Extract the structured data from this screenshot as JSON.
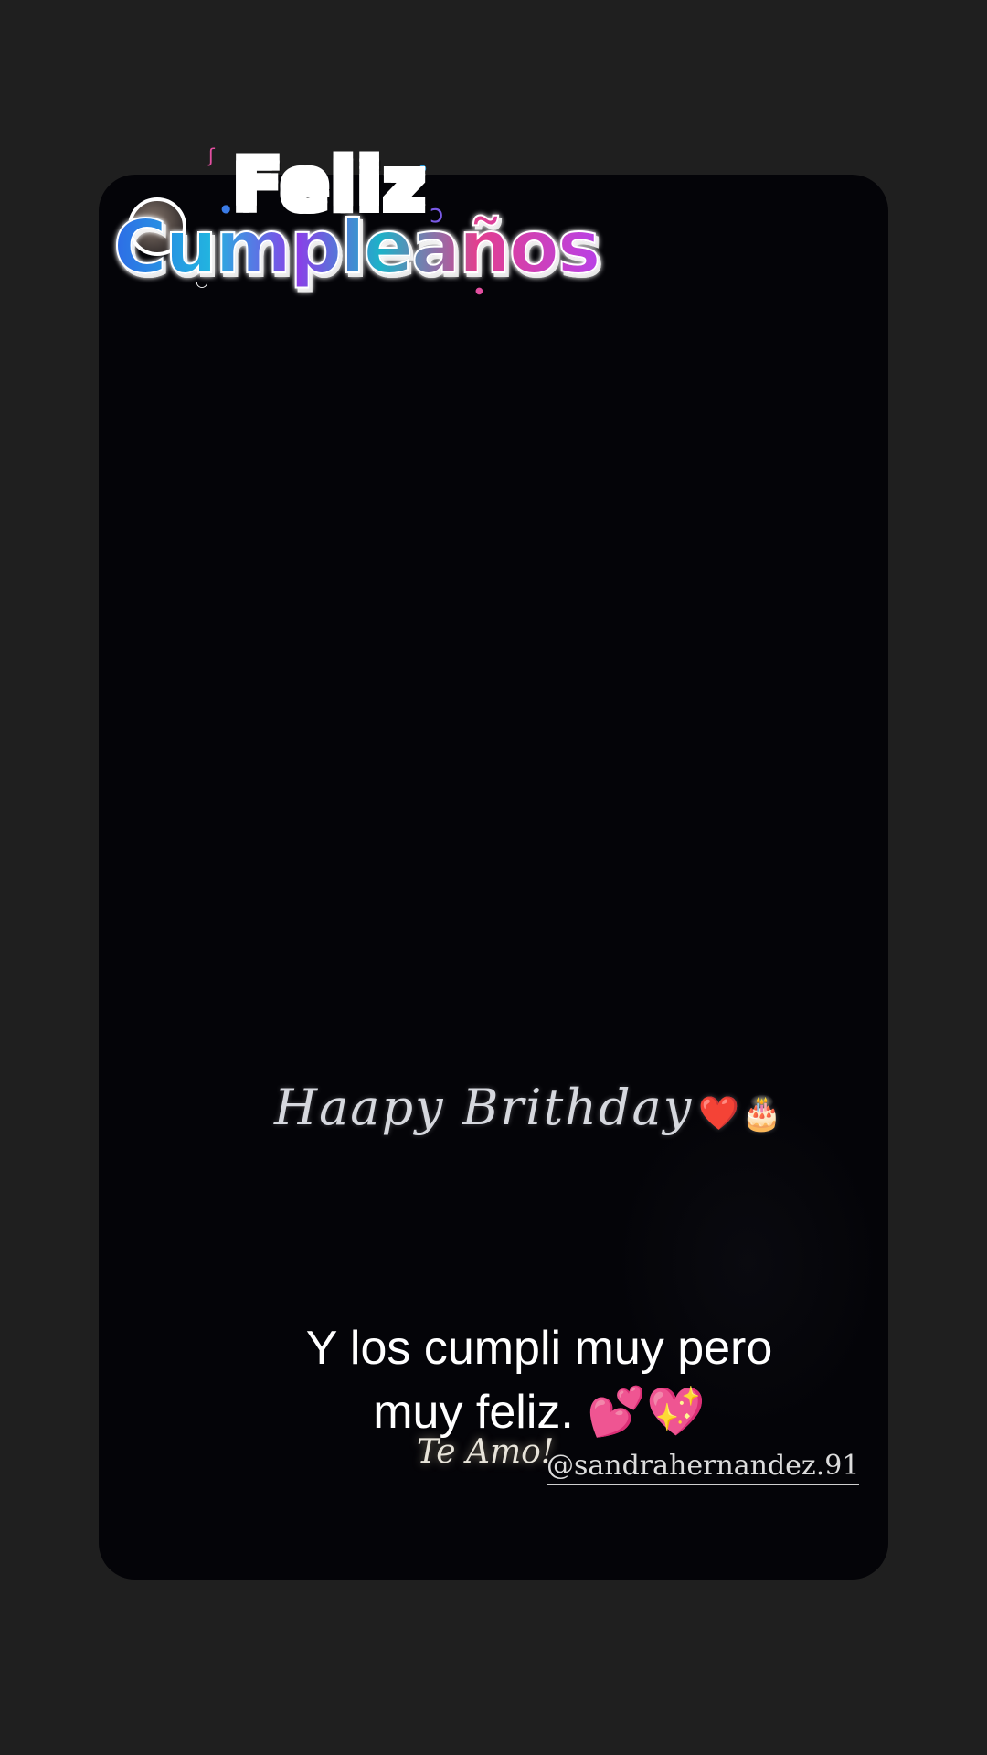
{
  "sticker": {
    "line1": "Feliz",
    "line2": "Cumpleaños"
  },
  "video": {
    "script_text": "Haapy Brithday",
    "script_emojis": "❤️🎂",
    "caption_line1": "Y los cumpli muy pero",
    "caption_line2": "muy feliz.  💕💖",
    "overlay_text": "Te Amo!",
    "handle": "@sandrahernandez.91"
  },
  "colors": {
    "page_background": "#1f1f1f",
    "video_background": "#040408",
    "caption_text": "#ffffff"
  }
}
